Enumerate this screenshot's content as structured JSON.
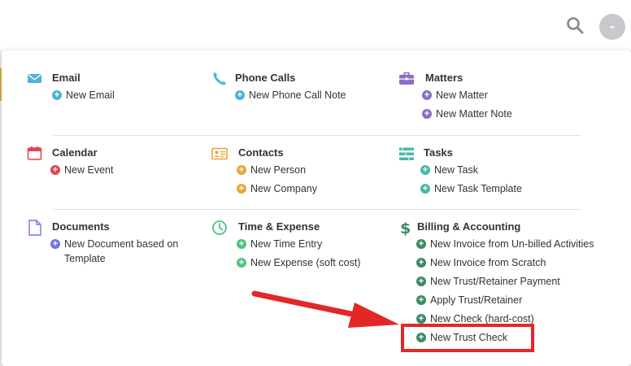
{
  "colors": {
    "blue": "#4fb1d6",
    "purple": "#8a6fc4",
    "red": "#e04550",
    "orange": "#e6a73a",
    "teal": "#4ab9a8",
    "indigo": "#6f78e0",
    "green": "#4fc47f",
    "darkgreen": "#3e8a63",
    "annotation_red": "#e32727"
  },
  "header": {
    "search_icon": "search-icon",
    "avatar_glyph": "-"
  },
  "sections": {
    "email": {
      "title": "Email",
      "icon": "envelope-icon",
      "items": [
        "New Email"
      ]
    },
    "phone": {
      "title": "Phone Calls",
      "icon": "phone-icon",
      "items": [
        "New Phone Call Note"
      ]
    },
    "matters": {
      "title": "Matters",
      "icon": "briefcase-icon",
      "items": [
        "New Matter",
        "New Matter Note"
      ]
    },
    "calendar": {
      "title": "Calendar",
      "icon": "calendar-icon",
      "items": [
        "New Event"
      ]
    },
    "contacts": {
      "title": "Contacts",
      "icon": "contact-card-icon",
      "items": [
        "New Person",
        "New Company"
      ]
    },
    "tasks": {
      "title": "Tasks",
      "icon": "task-list-icon",
      "items": [
        "New Task",
        "New Task Template"
      ]
    },
    "documents": {
      "title": "Documents",
      "icon": "document-icon",
      "items": [
        "New Document based on Template"
      ]
    },
    "time": {
      "title": "Time & Expense",
      "icon": "clock-icon",
      "items": [
        "New Time Entry",
        "New Expense (soft cost)"
      ]
    },
    "billing": {
      "title": "Billing & Accounting",
      "icon": "dollar-icon",
      "items": [
        "New Invoice from Un-billed Activities",
        "New Invoice from Scratch",
        "New Trust/Retainer Payment",
        "Apply Trust/Retainer",
        "New Check (hard-cost)",
        "New Trust Check"
      ]
    }
  },
  "annotation": {
    "target": "New Trust Check"
  }
}
